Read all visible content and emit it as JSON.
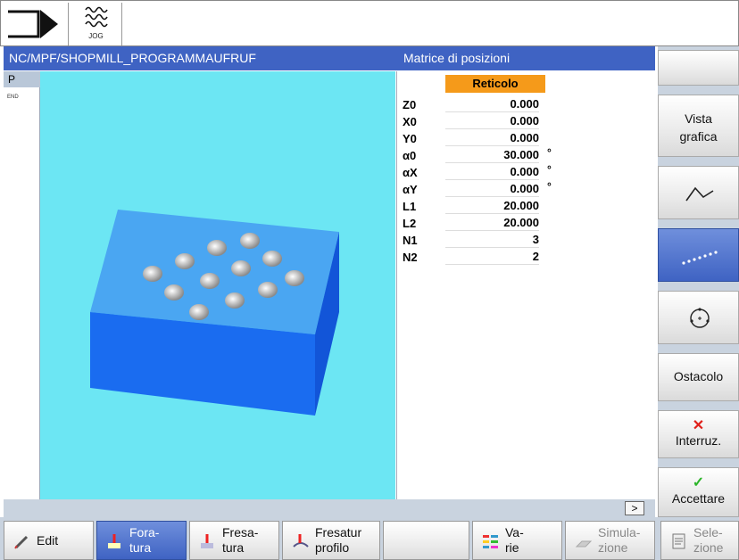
{
  "top": {
    "jog_label": "JOG"
  },
  "header": {
    "path": "NC/MPF/SHOPMILL_PROGRAMMAUFRUF",
    "title": "Matrice di posizioni"
  },
  "left": {
    "p_label": "P",
    "end_label": "END"
  },
  "params": {
    "header": "Reticolo",
    "rows": [
      {
        "name": "Z0",
        "value": "0.000",
        "unit": ""
      },
      {
        "name": "X0",
        "value": "0.000",
        "unit": ""
      },
      {
        "name": "Y0",
        "value": "0.000",
        "unit": ""
      },
      {
        "name": "α0",
        "value": "30.000",
        "unit": "°"
      },
      {
        "name": "αX",
        "value": "0.000",
        "unit": "°"
      },
      {
        "name": "αY",
        "value": "0.000",
        "unit": "°"
      },
      {
        "name": "L1",
        "value": "20.000",
        "unit": ""
      },
      {
        "name": "L2",
        "value": "20.000",
        "unit": ""
      },
      {
        "name": "N1",
        "value": "3",
        "unit": ""
      },
      {
        "name": "N2",
        "value": "2",
        "unit": ""
      }
    ]
  },
  "more_label": ">",
  "softkeys_v": {
    "vista_line1": "Vista",
    "vista_line2": "grafica",
    "ostacolo": "Ostacolo",
    "interruz": "Interruz.",
    "accettare": "Accettare"
  },
  "softkeys_h": {
    "edit": "Edit",
    "foratura_1": "Fora-",
    "foratura_2": "tura",
    "fresatura_1": "Fresa-",
    "fresatura_2": "tura",
    "fresprof_1": "Fresatur",
    "fresprof_2": "profilo",
    "varie_1": "Va-",
    "varie_2": "rie",
    "simul_1": "Simula-",
    "simul_2": "zione",
    "sele_1": "Sele-",
    "sele_2": "zione"
  },
  "colors": {
    "header_blue": "#3f63c3",
    "graphic_bg": "#6ce6f3",
    "orange": "#f59a1a"
  }
}
